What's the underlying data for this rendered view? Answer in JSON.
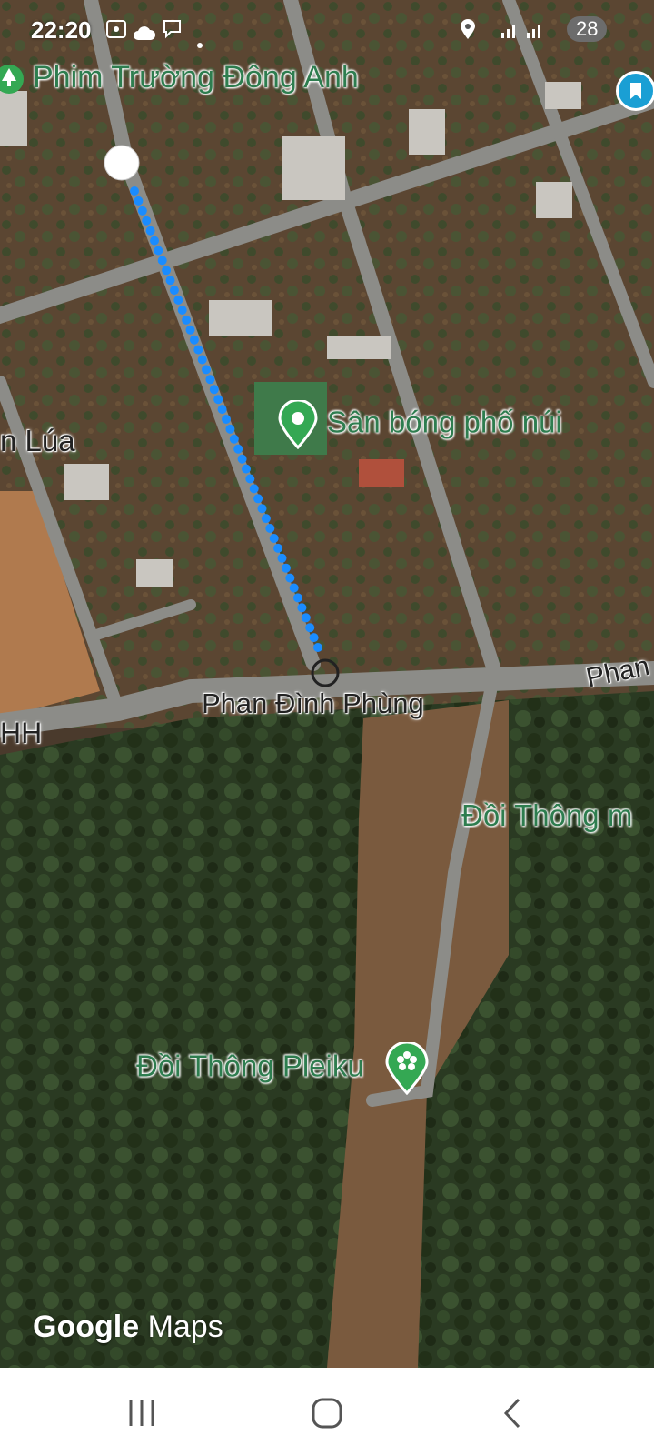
{
  "status": {
    "time": "22:20",
    "battery": "28"
  },
  "places": {
    "top_place": "Phim Trường Đông Anh",
    "stadium": "Sân bóng phố núi",
    "left_partial": "n Lúa",
    "left_partial_2": "HH",
    "hill_partial": "Đồi Thông m",
    "pine_hill": "Đồi Thông Pleiku"
  },
  "roads": {
    "main_road": "Phan Đình Phùng",
    "main_road_partial": "Phan"
  },
  "branding": {
    "google": "Google",
    "maps": "Maps"
  },
  "colors": {
    "route": "#1a8cff",
    "place_green": "#34a853",
    "bookmark": "#1a9fd4"
  },
  "icons": {
    "top_place": "tree-icon",
    "stadium": "place-pin-icon",
    "pine_hill": "flower-icon",
    "bookmark": "bookmark-icon"
  }
}
